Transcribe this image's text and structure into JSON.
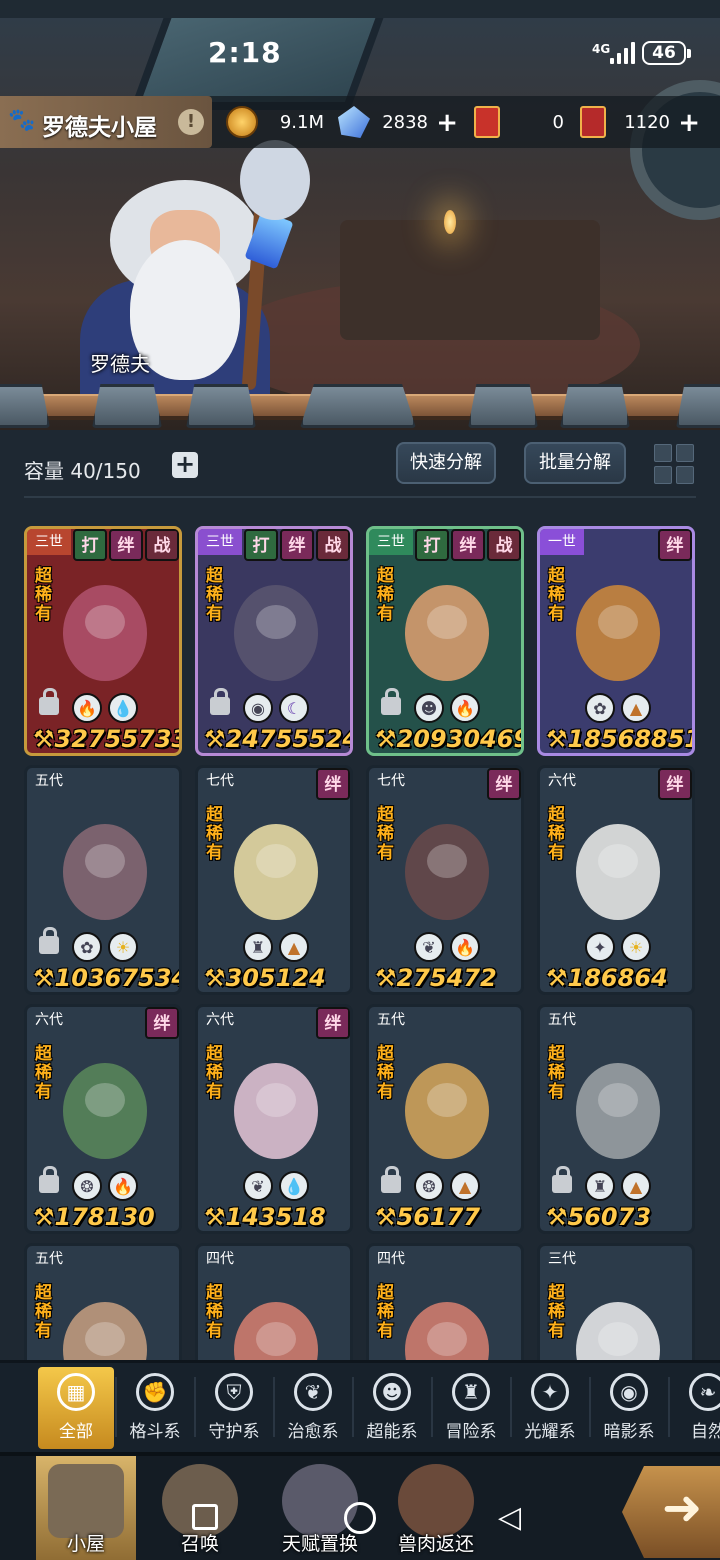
{
  "status_bar": {
    "time": "2:18",
    "network": "4G",
    "battery": "46"
  },
  "header": {
    "title": "罗德夫小屋",
    "info_icon": "!",
    "resources": [
      {
        "icon": "gold-coin-icon",
        "value": "9.1M"
      },
      {
        "icon": "blue-crystal-icon",
        "value": "2838",
        "plus": "+"
      },
      {
        "icon": "red-ticket-icon",
        "value": "0"
      },
      {
        "icon": "red-card-icon",
        "value": "1120",
        "plus": "+"
      }
    ]
  },
  "scene": {
    "npc_name": "罗德夫"
  },
  "toolbar": {
    "capacity_label": "容量 40/150",
    "capacity_plus": "+",
    "quick_decompose": "快速分解",
    "batch_decompose": "批量分解"
  },
  "cards": [
    {
      "gen": "三世",
      "rarity": "超稀有",
      "tags": [
        "打",
        "绊",
        "战"
      ],
      "elements": [
        "fire",
        "water"
      ],
      "power": "32755733",
      "theme": "red",
      "locked": true
    },
    {
      "gen": "三世",
      "rarity": "超稀有",
      "tags": [
        "打",
        "绊",
        "战"
      ],
      "elements": [
        "shadow",
        "moon"
      ],
      "power": "24755524",
      "theme": "purple",
      "locked": true
    },
    {
      "gen": "三世",
      "rarity": "超稀有",
      "tags": [
        "打",
        "绊",
        "战"
      ],
      "elements": [
        "psychic",
        "fire"
      ],
      "power": "20930469",
      "theme": "green",
      "locked": true
    },
    {
      "gen": "一世",
      "rarity": "超稀有",
      "tags": [
        "绊"
      ],
      "elements": [
        "guard",
        "earth"
      ],
      "power": "18568851",
      "theme": "violet",
      "locked": false
    },
    {
      "gen": "五代",
      "rarity": "",
      "tags": [],
      "elements": [
        "guard",
        "light"
      ],
      "power": "10367534",
      "theme": "blue",
      "locked": true
    },
    {
      "gen": "七代",
      "rarity": "超稀有",
      "tags": [
        "绊"
      ],
      "elements": [
        "adventure",
        "earth"
      ],
      "power": "305124",
      "theme": "blue",
      "locked": false
    },
    {
      "gen": "七代",
      "rarity": "超稀有",
      "tags": [
        "绊"
      ],
      "elements": [
        "leaf",
        "fire"
      ],
      "power": "275472",
      "theme": "blue",
      "locked": false
    },
    {
      "gen": "六代",
      "rarity": "超稀有",
      "tags": [
        "绊"
      ],
      "elements": [
        "shine",
        "light"
      ],
      "power": "186864",
      "theme": "blue",
      "locked": false
    },
    {
      "gen": "六代",
      "rarity": "超稀有",
      "tags": [
        "绊"
      ],
      "elements": [
        "wind",
        "fire"
      ],
      "power": "178130",
      "theme": "blue",
      "locked": true
    },
    {
      "gen": "六代",
      "rarity": "超稀有",
      "tags": [
        "绊"
      ],
      "elements": [
        "leaf",
        "water"
      ],
      "power": "143518",
      "theme": "blue",
      "locked": false
    },
    {
      "gen": "五代",
      "rarity": "超稀有",
      "tags": [],
      "elements": [
        "wind",
        "earth"
      ],
      "power": "56177",
      "theme": "blue",
      "locked": true
    },
    {
      "gen": "五代",
      "rarity": "超稀有",
      "tags": [],
      "elements": [
        "adventure",
        "earth"
      ],
      "power": "56073",
      "theme": "blue",
      "locked": true
    },
    {
      "gen": "五代",
      "rarity": "超稀有",
      "tags": [],
      "elements": [],
      "power": "",
      "theme": "blue",
      "locked": false
    },
    {
      "gen": "四代",
      "rarity": "超稀有",
      "tags": [],
      "elements": [],
      "power": "",
      "theme": "blue",
      "locked": false
    },
    {
      "gen": "四代",
      "rarity": "超稀有",
      "tags": [],
      "elements": [],
      "power": "",
      "theme": "blue",
      "locked": false
    },
    {
      "gen": "三代",
      "rarity": "超稀有",
      "tags": [],
      "elements": [],
      "power": "",
      "theme": "blue",
      "locked": false
    }
  ],
  "categories": [
    {
      "label": "全部",
      "icon": "all-blocks-icon",
      "active": true
    },
    {
      "label": "格斗系",
      "icon": "fist-icon"
    },
    {
      "label": "守护系",
      "icon": "shield-icon"
    },
    {
      "label": "治愈系",
      "icon": "sprout-icon"
    },
    {
      "label": "超能系",
      "icon": "alien-head-icon"
    },
    {
      "label": "冒险系",
      "icon": "tower-icon"
    },
    {
      "label": "光耀系",
      "icon": "star-compass-icon"
    },
    {
      "label": "暗影系",
      "icon": "shadow-eye-icon"
    },
    {
      "label": "自然",
      "icon": "leaf-icon"
    }
  ],
  "bottom_nav": [
    {
      "label": "小屋",
      "icon": "house-icon",
      "active": true
    },
    {
      "label": "召唤",
      "icon": "egg-icon"
    },
    {
      "label": "天赋置换",
      "icon": "swap-arrows-icon"
    },
    {
      "label": "兽肉返还",
      "icon": "meat-icon"
    }
  ],
  "colors": {
    "accent_gold": "#f4c84a",
    "power_text": "#ffc94a",
    "rarity_text": "#ffb11b",
    "panel_bg": "#1e2832"
  }
}
